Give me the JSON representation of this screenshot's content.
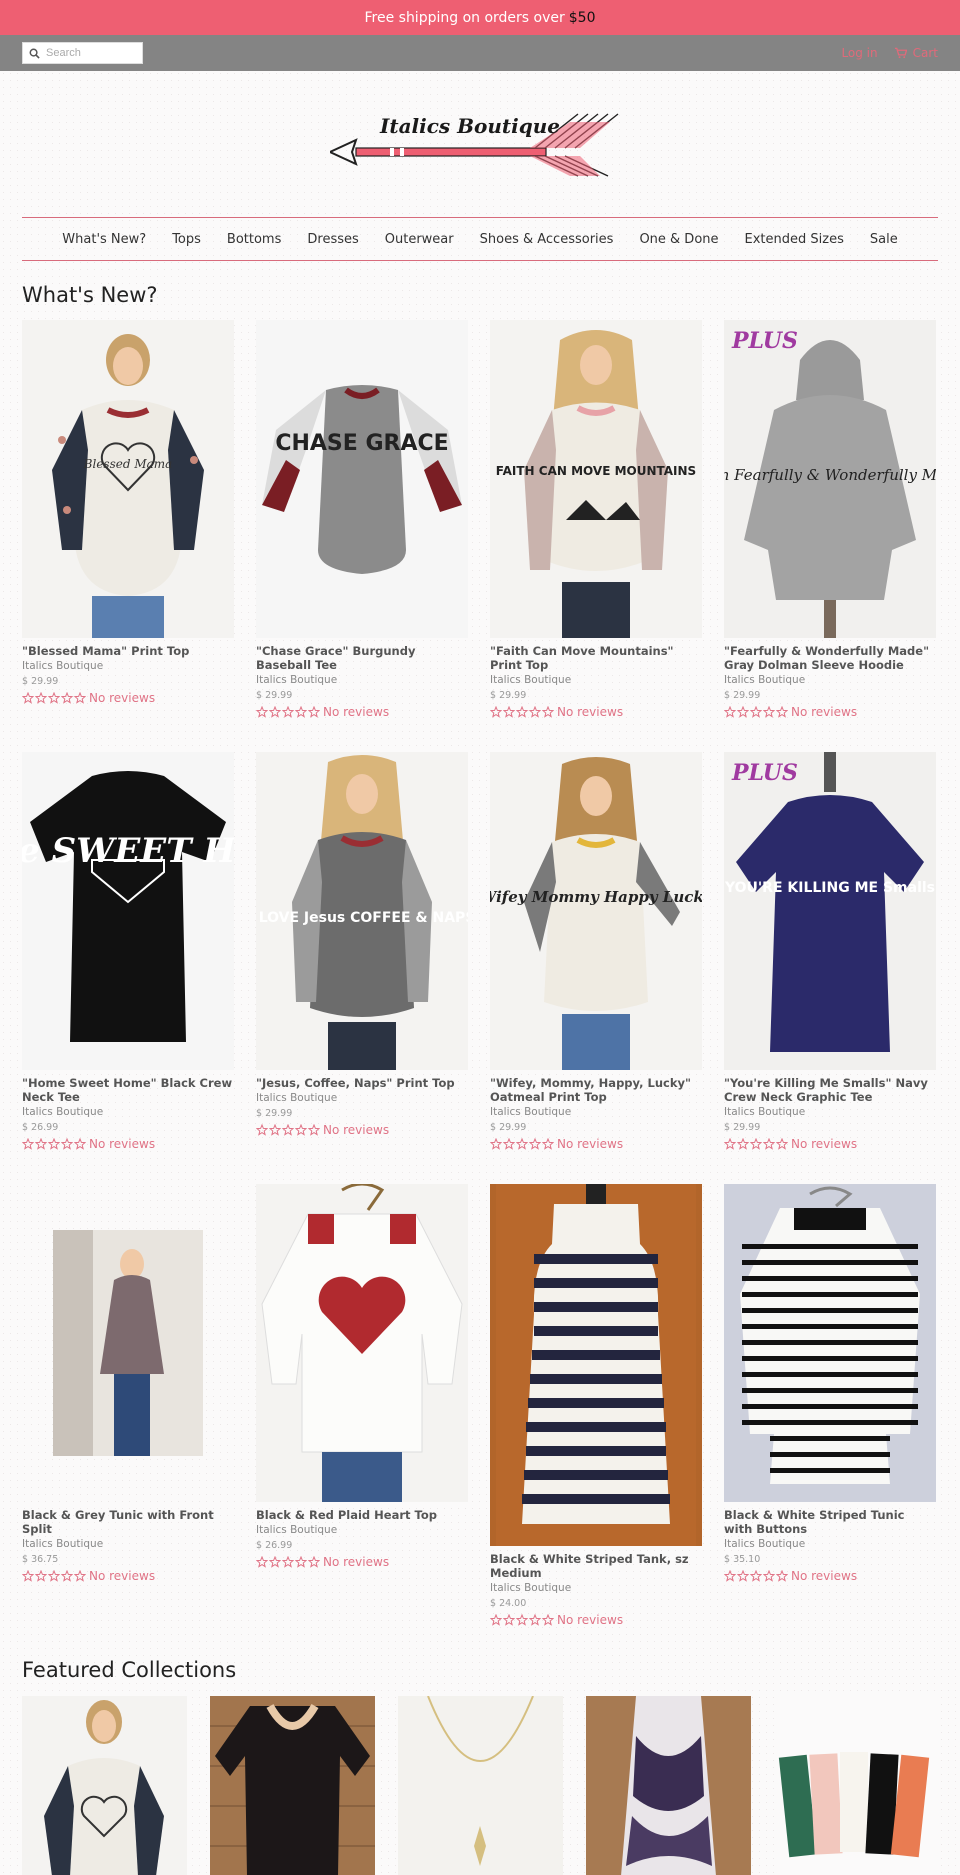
{
  "announcement": {
    "text": "Free shipping on orders over",
    "amount": "$50"
  },
  "topbar": {
    "search_placeholder": "Search",
    "login_label": "Log in",
    "cart_label": "Cart"
  },
  "brand": {
    "name": "Italics Boutique",
    "accent": "#ee5f72"
  },
  "nav": {
    "items": [
      "What's New?",
      "Tops",
      "Bottoms",
      "Dresses",
      "Outerwear",
      "Shoes & Accessories",
      "One & Done",
      "Extended Sizes",
      "Sale"
    ]
  },
  "whats_new": {
    "title": "What's New?",
    "products": [
      {
        "title": "\"Blessed Mama\" Print Top",
        "vendor": "Italics Boutique",
        "price": "$ 29.99",
        "reviews": "No reviews",
        "img": "tee-raglan-floral"
      },
      {
        "title": "\"Chase Grace\" Burgundy Baseball Tee",
        "vendor": "Italics Boutique",
        "price": "$ 29.99",
        "reviews": "No reviews",
        "img": "tee-raglan-burgundy"
      },
      {
        "title": "\"Faith Can Move Mountains\" Print Top",
        "vendor": "Italics Boutique",
        "price": "$ 29.99",
        "reviews": "No reviews",
        "img": "tee-raglan-stripe"
      },
      {
        "title": "\"Fearfully & Wonderfully Made\" Gray Dolman Sleeve Hoodie",
        "vendor": "Italics Boutique",
        "price": "$ 29.99",
        "reviews": "No reviews",
        "img": "hoodie-gray"
      },
      {
        "title": "\"Home Sweet Home\" Black Crew Neck Tee",
        "vendor": "Italics Boutique",
        "price": "$ 26.99",
        "reviews": "No reviews",
        "img": "tee-black"
      },
      {
        "title": "\"Jesus, Coffee, Naps\" Print Top",
        "vendor": "Italics Boutique",
        "price": "$ 29.99",
        "reviews": "No reviews",
        "img": "tee-raglan-gray"
      },
      {
        "title": "\"Wifey, Mommy, Happy, Lucky\" Oatmeal Print Top",
        "vendor": "Italics Boutique",
        "price": "$ 29.99",
        "reviews": "No reviews",
        "img": "tee-raglan-oatmeal"
      },
      {
        "title": "\"You're Killing Me Smalls\" Navy Crew Neck Graphic Tee",
        "vendor": "Italics Boutique",
        "price": "$ 29.99",
        "reviews": "No reviews",
        "img": "tee-navy"
      },
      {
        "title": "Black & Grey Tunic with Front Split",
        "vendor": "Italics Boutique",
        "price": "$ 36.75",
        "reviews": "No reviews",
        "img": "tunic-gray"
      },
      {
        "title": "Black & Red Plaid Heart Top",
        "vendor": "Italics Boutique",
        "price": "$ 26.99",
        "reviews": "No reviews",
        "img": "top-heart"
      },
      {
        "title": "Black & White Striped Tank, sz Medium",
        "vendor": "Italics Boutique",
        "price": "$ 24.00",
        "reviews": "No reviews",
        "img": "tank-striped"
      },
      {
        "title": "Black & White Striped Tunic with Buttons",
        "vendor": "Italics Boutique",
        "price": "$ 35.10",
        "reviews": "No reviews",
        "img": "tunic-striped"
      }
    ]
  },
  "product_texts": {
    "blessed": "Blessed Mama",
    "chase": "CHASE GRACE",
    "faith": "FAITH CAN MOVE MOUNTAINS",
    "fearfully": "I am Fearfully & Wonderfully Made",
    "home": "Home SWEET HOME",
    "jesus": "I LOVE Jesus COFFEE & NAPS",
    "wifey": "Wifey Mommy Happy Lucky",
    "smalls": "YOU'RE KILLING ME Smalls",
    "plus": "PLUS"
  },
  "featured": {
    "title": "Featured Collections"
  },
  "colors": {
    "pink": "#ee5f72",
    "topbar": "#848484",
    "review": "#e07386"
  }
}
